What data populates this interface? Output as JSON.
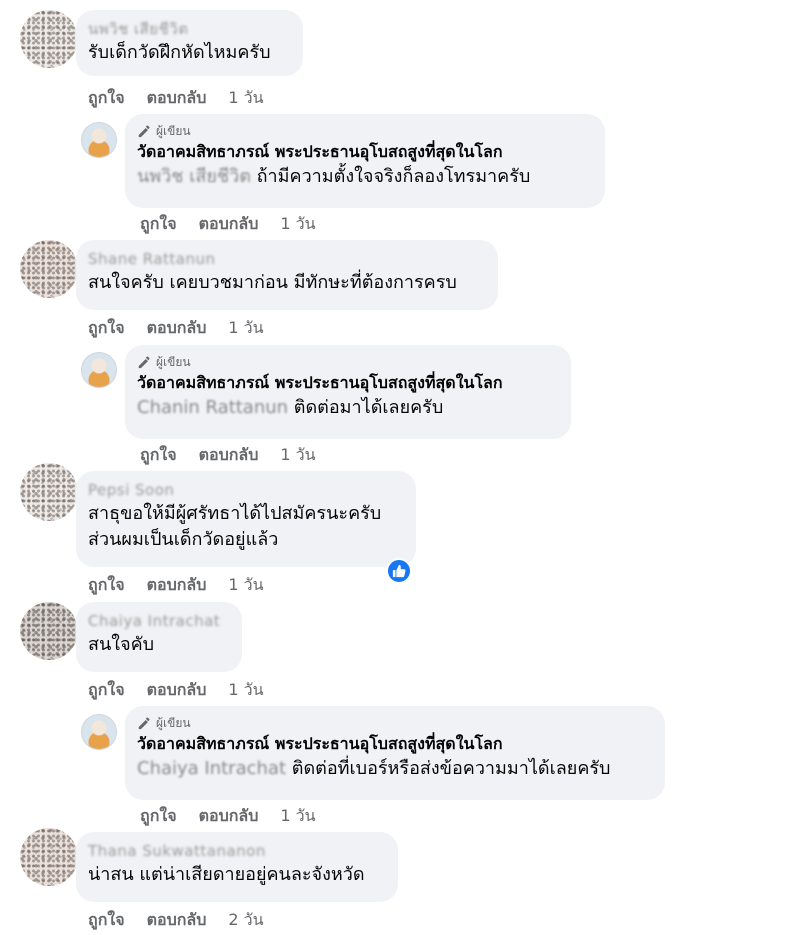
{
  "badge_label": "ผู้เขียน",
  "page_name": "วัดอาคมสิทธาภรณ์ พระประธานอุโบสถสูงที่สุดในโลก",
  "action_like": "ถูกใจ",
  "action_reply": "ตอบกลับ",
  "comments": [
    {
      "author": "นพวิช เสียชีวิต",
      "lines": [
        "รับเด็กวัดฝึกหัดไหมครับ"
      ],
      "time": "1 วัน"
    },
    {
      "tag": "นพวิช เสียชีวิต",
      "reply": "ถ้ามีความตั้งใจจริงก็ลองโทรมาครับ",
      "time": "1 วัน"
    },
    {
      "author": "Shane Rattanun",
      "lines": [
        "สนใจครับ เคยบวชมาก่อน มีทักษะที่ต้องการครบ"
      ],
      "time": "1 วัน"
    },
    {
      "tag": "Chanin Rattanun",
      "reply": "ติดต่อมาได้เลยครับ",
      "time": "1 วัน"
    },
    {
      "author": "Pepsi Soon",
      "lines": [
        "สาธุขอให้มีผู้ศรัทธาได้ไปสมัครนะครับ",
        "ส่วนผมเป็นเด็กวัดอยู่แล้ว"
      ],
      "time": "1 วัน"
    },
    {
      "author": "Chaiya Intrachat",
      "lines": [
        "สนใจคับ"
      ],
      "time": "1 วัน"
    },
    {
      "tag": "Chaiya Intrachat",
      "reply": "ติดต่อที่เบอร์หรือส่งข้อความมาได้เลยครับ",
      "time": "1 วัน"
    },
    {
      "author": "Thana Sukwattananon",
      "lines": [
        "น่าสน แต่น่าเสียดายอยู่คนละจังหวัด"
      ],
      "time": "2 วัน"
    }
  ],
  "colors": {
    "bubble": "#f0f2f5",
    "meta": "#65676b",
    "like_blue": "#1877f2"
  },
  "icons": [
    "pencil-icon",
    "thumbs-up-icon"
  ]
}
